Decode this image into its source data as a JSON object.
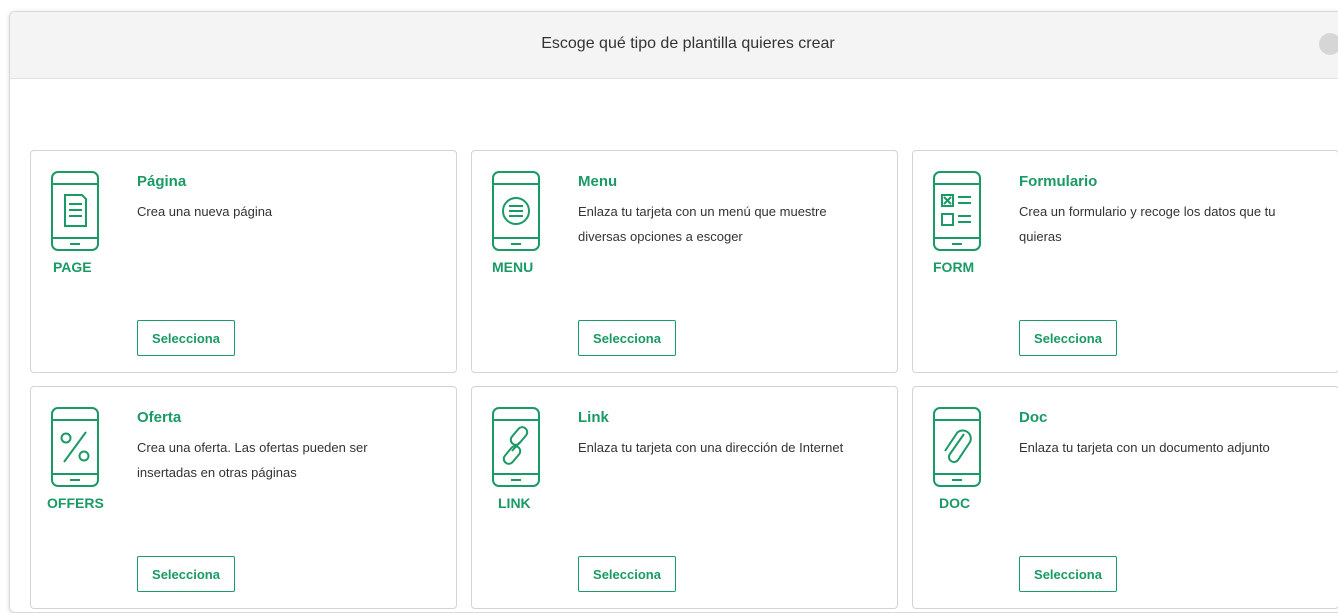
{
  "modal": {
    "title": "Escoge qué tipo de plantilla quieres crear"
  },
  "accent_color": "#1a9a64",
  "cards": [
    {
      "icon": "page-icon",
      "icon_label": "PAGE",
      "title": "Página",
      "description": "Crea una nueva página",
      "button": "Selecciona"
    },
    {
      "icon": "menu-icon",
      "icon_label": "MENU",
      "title": "Menu",
      "description": "Enlaza tu tarjeta con un menú que muestre diversas opciones a escoger",
      "button": "Selecciona"
    },
    {
      "icon": "form-icon",
      "icon_label": "FORM",
      "title": "Formulario",
      "description": "Crea un formulario y recoge los datos que tu quieras",
      "button": "Selecciona"
    },
    {
      "icon": "offers-icon",
      "icon_label": "OFFERS",
      "title": "Oferta",
      "description": "Crea una oferta. Las ofertas pueden ser insertadas en otras páginas",
      "button": "Selecciona"
    },
    {
      "icon": "link-icon",
      "icon_label": "LINK",
      "title": "Link",
      "description": "Enlaza tu tarjeta con una dirección de Internet",
      "button": "Selecciona"
    },
    {
      "icon": "doc-icon",
      "icon_label": "DOC",
      "title": "Doc",
      "description": "Enlaza tu tarjeta con un documento adjunto",
      "button": "Selecciona"
    }
  ]
}
